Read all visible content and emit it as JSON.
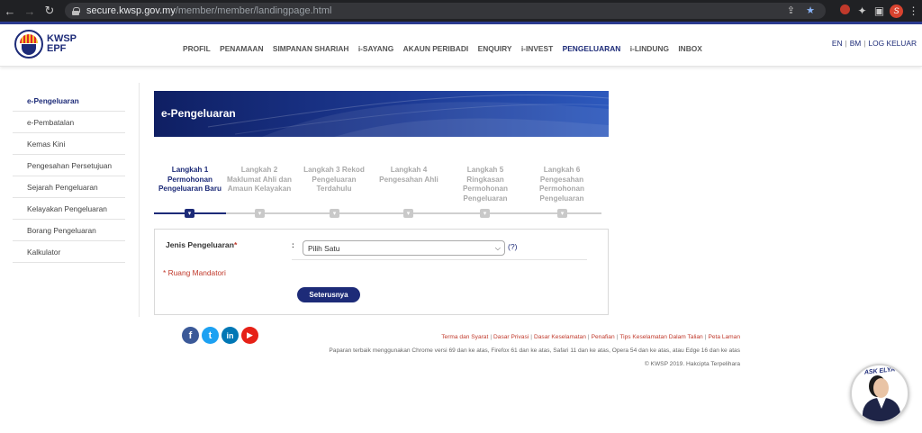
{
  "browser": {
    "host": "secure.kwsp.gov.my",
    "path": "/member/member/landingpage.html",
    "profile_initial": "S"
  },
  "header": {
    "logo_line1": "KWSP",
    "logo_line2": "EPF",
    "nav": [
      "PROFIL",
      "PENAMAAN",
      "SIMPANAN SHARIAH",
      "i-SAYANG",
      "AKAUN PERIBADI",
      "ENQUIRY",
      "i-INVEST",
      "PENGELUARAN",
      "i-LINDUNG",
      "INBOX"
    ],
    "active_nav": "PENGELUARAN",
    "lang_en": "EN",
    "lang_bm": "BM",
    "logout": "LOG KELUAR"
  },
  "sidebar": {
    "items": [
      "e-Pengeluaran",
      "e-Pembatalan",
      "Kemas Kini",
      "Pengesahan Persetujuan",
      "Sejarah Pengeluaran",
      "Kelayakan Pengeluaran",
      "Borang Pengeluaran",
      "Kalkulator"
    ],
    "active": "e-Pengeluaran"
  },
  "banner": {
    "title": "e-Pengeluaran"
  },
  "steps": [
    {
      "label": "Langkah 1 Permohonan Pengeluaran Baru",
      "active": true
    },
    {
      "label": "Langkah 2 Maklumat Ahli dan Amaun Kelayakan",
      "active": false
    },
    {
      "label": "Langkah 3 Rekod Pengeluaran Terdahulu",
      "active": false
    },
    {
      "label": "Langkah 4 Pengesahan Ahli",
      "active": false
    },
    {
      "label": "Langkah 5 Ringkasan Permohonan Pengeluaran",
      "active": false
    },
    {
      "label": "Langkah 6 Pengesahan Permohonan Pengeluaran",
      "active": false
    }
  ],
  "form": {
    "field_label": "Jenis Pengeluaran",
    "required_mark": "*",
    "colon": ":",
    "select_value": "Pilih Satu",
    "help": "(?)",
    "mandatory_note": "* Ruang Mandatori",
    "next_button": "Seterusnya"
  },
  "social": [
    "f",
    "t",
    "in",
    "▶"
  ],
  "footer": {
    "links": [
      "Terma dan Syarat",
      "Dasar Privasi",
      "Dasar Keselamatan",
      "Penafian",
      "Tips Keselamatan Dalam Talian",
      "Peta Laman"
    ],
    "browser_note": "Paparan terbaik menggunakan Chrome versi 69 dan ke atas, Firefox 61 dan ke atas, Safari 11 dan ke atas, Opera 54 dan ke atas, atau Edge 16 dan ke atas",
    "copyright": "© KWSP 2019. Hakcipta Terpelihara"
  },
  "ask_elya": {
    "label": "ASK ELYA"
  },
  "colors": {
    "brand": "#1d2b78",
    "mandatory": "#c0392b",
    "facebook": "#3b5998",
    "twitter": "#1da1f2",
    "linkedin": "#0077b5",
    "youtube": "#e62117"
  }
}
